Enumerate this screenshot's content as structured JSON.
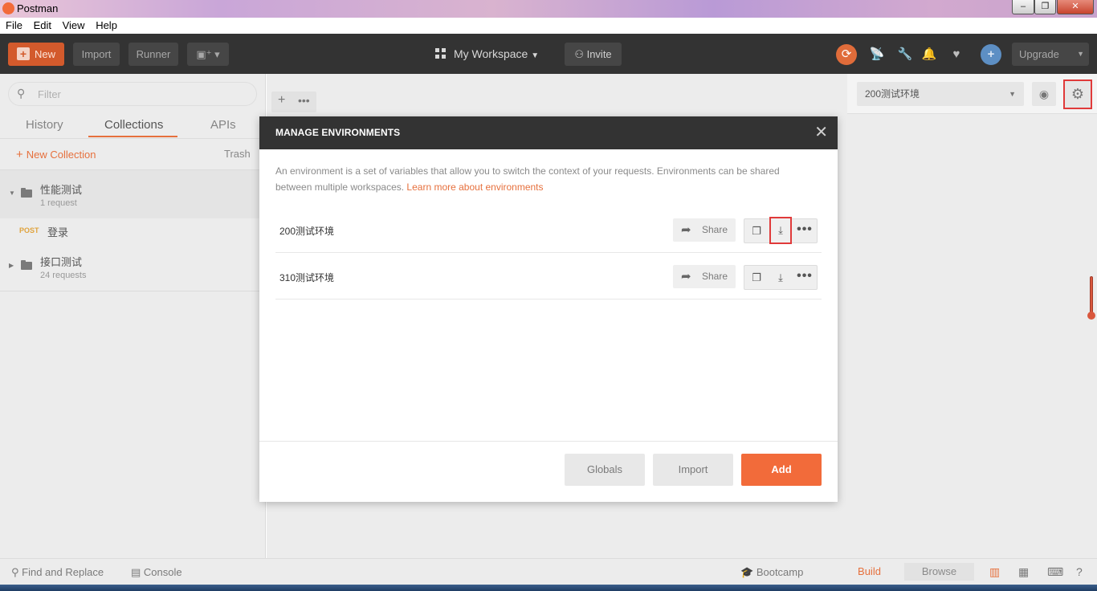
{
  "window": {
    "title": "Postman",
    "min": "–",
    "max": "❐",
    "close": "✕"
  },
  "menu": [
    "File",
    "Edit",
    "View",
    "Help"
  ],
  "header": {
    "new_label": "New",
    "import_label": "Import",
    "runner_label": "Runner",
    "workspace_label": "My Workspace",
    "invite_label": "Invite",
    "upgrade_label": "Upgrade"
  },
  "sidebar": {
    "filter_placeholder": "Filter",
    "tabs": {
      "history": "History",
      "collections": "Collections",
      "apis": "APIs"
    },
    "new_collection": "New Collection",
    "trash": "Trash",
    "collections": [
      {
        "name": "性能测试",
        "count": "1 request",
        "expanded": true
      },
      {
        "name": "接口测试",
        "count": "24 requests",
        "expanded": false
      }
    ],
    "request": {
      "method": "POST",
      "name": "登录"
    }
  },
  "environment": {
    "selected": "200测试环境"
  },
  "modal": {
    "title": "MANAGE ENVIRONMENTS",
    "description": "An environment is a set of variables that allow you to switch the context of your requests. Environments can be shared between multiple workspaces.",
    "learn_more": "Learn more about environments",
    "environments": [
      {
        "name": "200测试环境",
        "share": "Share"
      },
      {
        "name": "310测试环境",
        "share": "Share"
      }
    ],
    "buttons": {
      "globals": "Globals",
      "import": "Import",
      "add": "Add"
    }
  },
  "statusbar": {
    "find_replace": "Find and Replace",
    "console": "Console",
    "bootcamp": "Bootcamp",
    "build": "Build",
    "browse": "Browse"
  },
  "colors": {
    "accent": "#f26b3a",
    "header": "#333333",
    "highlight": "#e03a3a"
  }
}
